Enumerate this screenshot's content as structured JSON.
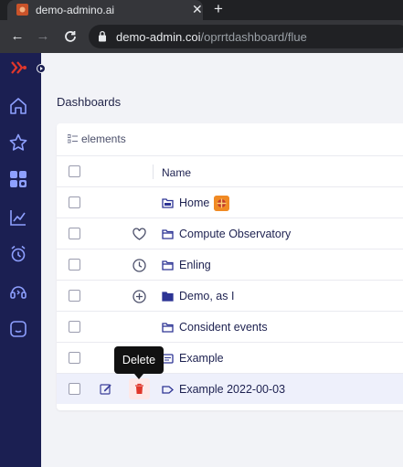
{
  "browser": {
    "tab_title": "demo-admino.ai",
    "url_host": "demo-admin.coi",
    "url_path": "/oprrtdashboard/flue"
  },
  "colors": {
    "sidebar": "#1b1f52",
    "sidebar_icon": "#8ea0ff",
    "accent": "#e0372b",
    "row_hover": "#eef0fb"
  },
  "sidebar": {
    "icons": [
      "logo-icon",
      "home-icon",
      "star-icon",
      "dashboard-icon",
      "chart-icon",
      "alarm-icon",
      "support-icon",
      "chat-icon"
    ]
  },
  "main": {
    "page_title": "Dashboards",
    "card_header": "elements",
    "column_name": "Name",
    "rows": [
      {
        "label": "Home",
        "action_icon": "",
        "has_badge": true
      },
      {
        "label": "Compute Observatory",
        "action_icon": "heart-icon"
      },
      {
        "label": "Enling",
        "action_icon": "clock-icon"
      },
      {
        "label": "Demo, as I",
        "action_icon": "plus-circle-icon"
      },
      {
        "label": "Consident events",
        "action_icon": ""
      },
      {
        "label": "Example",
        "action_icon": ""
      },
      {
        "label": "Example 2022-00-03",
        "action_icon": "",
        "hovered": true
      }
    ],
    "tooltip": "Delete"
  }
}
